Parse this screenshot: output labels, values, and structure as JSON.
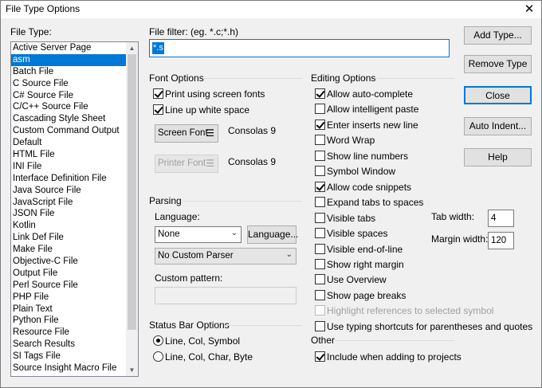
{
  "window": {
    "title": "File Type Options",
    "close_glyph": "✕"
  },
  "file_type": {
    "label": "File Type:",
    "items": [
      "Active Server Page",
      "asm",
      "Batch File",
      "C Source File",
      "C# Source File",
      "C/C++ Source File",
      "Cascading Style Sheet",
      "Custom Command Output",
      "Default",
      "HTML File",
      "INI File",
      "Interface Definition File",
      "Java Source File",
      "JavaScript File",
      "JSON File",
      "Kotlin",
      "Link Def File",
      "Make File",
      "Objective-C File",
      "Output File",
      "Perl Source File",
      "PHP File",
      "Plain Text",
      "Python File",
      "Resource File",
      "Search Results",
      "SI Tags File",
      "Source Insight Macro File"
    ],
    "selected_index": 1
  },
  "file_filter": {
    "label": "File filter: (eg. *.c;*.h)",
    "value": "*.s"
  },
  "font_options": {
    "heading": "Font Options",
    "print_screen_fonts": {
      "label": "Print using screen fonts",
      "checked": true
    },
    "line_up_white_space": {
      "label": "Line up white space",
      "checked": true
    },
    "screen_font_button": "Screen Font",
    "screen_font_value": "Consolas 9",
    "printer_font_button": "Printer Font",
    "printer_font_value": "Consolas 9",
    "menu_glyph": "☰"
  },
  "parsing": {
    "heading": "Parsing",
    "language_label": "Language:",
    "language_value": "None",
    "language_button": "Language...",
    "parser_value": "No Custom Parser",
    "custom_pattern_label": "Custom pattern:",
    "custom_pattern_value": "",
    "chevron_glyph": "⌄"
  },
  "status_bar": {
    "heading": "Status Bar Options",
    "options": [
      "Line, Col, Symbol",
      "Line, Col, Char, Byte"
    ],
    "selected_index": 0
  },
  "editing_options": {
    "heading": "Editing Options",
    "items": [
      {
        "label": "Allow auto-complete",
        "checked": true,
        "disabled": false
      },
      {
        "label": "Allow intelligent paste",
        "checked": false,
        "disabled": false
      },
      {
        "label": "Enter inserts new line",
        "checked": true,
        "disabled": false
      },
      {
        "label": "Word Wrap",
        "checked": false,
        "disabled": false
      },
      {
        "label": "Show line numbers",
        "checked": false,
        "disabled": false
      },
      {
        "label": "Symbol Window",
        "checked": false,
        "disabled": false
      },
      {
        "label": "Allow code snippets",
        "checked": true,
        "disabled": false
      },
      {
        "label": "Expand tabs to spaces",
        "checked": false,
        "disabled": false
      },
      {
        "label": "Visible tabs",
        "checked": false,
        "disabled": false
      },
      {
        "label": "Visible spaces",
        "checked": false,
        "disabled": false
      },
      {
        "label": "Visible end-of-line",
        "checked": false,
        "disabled": false
      },
      {
        "label": "Show right margin",
        "checked": false,
        "disabled": false
      },
      {
        "label": "Use Overview",
        "checked": false,
        "disabled": false
      },
      {
        "label": "Show page breaks",
        "checked": false,
        "disabled": false
      },
      {
        "label": "Highlight references to selected symbol",
        "checked": false,
        "disabled": true
      },
      {
        "label": "Use typing shortcuts for parentheses and quotes",
        "checked": false,
        "disabled": false
      }
    ],
    "tab_width_label": "Tab width:",
    "tab_width_value": "4",
    "margin_width_label": "Margin width:",
    "margin_width_value": "120"
  },
  "other": {
    "heading": "Other",
    "include_projects": {
      "label": "Include when adding to projects",
      "checked": true
    }
  },
  "buttons": {
    "add_type": "Add Type...",
    "remove_type": "Remove Type",
    "close": "Close",
    "auto_indent": "Auto Indent...",
    "help": "Help"
  },
  "scrollbar": {
    "up_glyph": "▲",
    "down_glyph": "▼"
  }
}
